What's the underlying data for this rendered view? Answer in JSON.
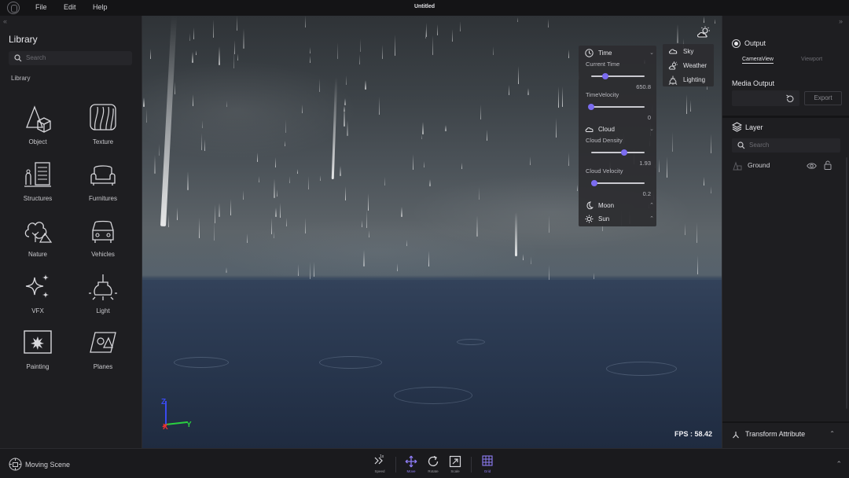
{
  "menubar": {
    "menus": [
      "File",
      "Edit",
      "Help"
    ],
    "title": "Untitled"
  },
  "library": {
    "heading": "Library",
    "search_placeholder": "Search",
    "subheading": "Library",
    "items": [
      {
        "label": "Object",
        "icon": "object-icon"
      },
      {
        "label": "Texture",
        "icon": "texture-icon"
      },
      {
        "label": "Structures",
        "icon": "structures-icon"
      },
      {
        "label": "Furnitures",
        "icon": "furnitures-icon"
      },
      {
        "label": "Nature",
        "icon": "nature-icon"
      },
      {
        "label": "Vehicles",
        "icon": "vehicles-icon"
      },
      {
        "label": "VFX",
        "icon": "vfx-icon"
      },
      {
        "label": "Light",
        "icon": "light-icon"
      },
      {
        "label": "Painting",
        "icon": "painting-icon"
      },
      {
        "label": "Planes",
        "icon": "planes-icon"
      }
    ]
  },
  "viewport": {
    "fps": "FPS : 58.42",
    "axes": {
      "x": "X",
      "y": "Y",
      "z": "Z"
    }
  },
  "environment": {
    "time": {
      "header": "Time",
      "current_time_label": "Current Time",
      "current_time_value": "650.8",
      "current_time_fraction": 0.27,
      "velocity_label": "TimeVelocity",
      "velocity_value": "0",
      "velocity_fraction": 0.0
    },
    "cloud": {
      "header": "Cloud",
      "density_label": "Cloud Density",
      "density_value": "1.93",
      "density_fraction": 0.62,
      "velocity_label": "Cloud Velocity",
      "velocity_value": "0.2",
      "velocity_fraction": 0.06
    },
    "moon": {
      "header": "Moon"
    },
    "sun": {
      "header": "Sun"
    }
  },
  "sky_menu": {
    "items": [
      "Sky",
      "Weather",
      "Lighting"
    ]
  },
  "output": {
    "title": "Output",
    "tabs": [
      "CameraView",
      "Viewport"
    ],
    "active_tab": "CameraView",
    "media_output_label": "Media Output",
    "export_label": "Export"
  },
  "layer": {
    "title": "Layer",
    "search_placeholder": "Search",
    "rows": [
      {
        "name": "Ground"
      }
    ]
  },
  "transform": {
    "label": "Transform Attribute"
  },
  "bottom": {
    "moving_scene": "Moving Scene",
    "speed_badge": "1x",
    "tools": [
      {
        "label": "Speed",
        "icon": "speed-icon"
      },
      {
        "label": "Move",
        "icon": "move-icon"
      },
      {
        "label": "Rotate",
        "icon": "rotate-icon"
      },
      {
        "label": "Scale",
        "icon": "scale-icon"
      },
      {
        "label": "Grid",
        "icon": "grid-icon"
      }
    ],
    "accent": "#8e7cf5"
  },
  "colors": {
    "accent": "#7b6cf0",
    "panel": "#1e1e21",
    "background": "#141416"
  }
}
